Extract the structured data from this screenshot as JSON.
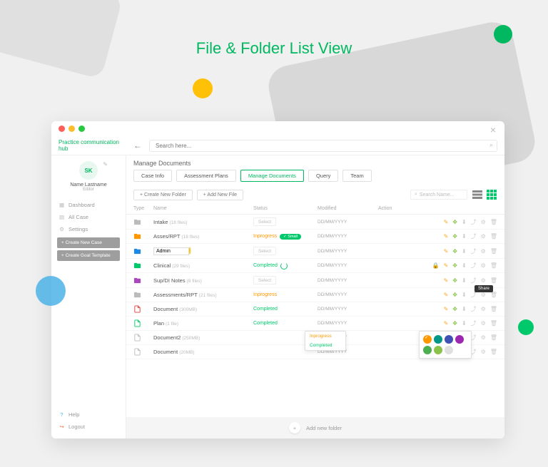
{
  "page_title": "File & Folder List View",
  "brand": "Practice communication hub",
  "search_placeholder": "Search here...",
  "user": {
    "initials": "SK",
    "name": "Name Lastname",
    "role": "Editor"
  },
  "nav": [
    {
      "icon": "▦",
      "label": "Dashboard"
    },
    {
      "icon": "▤",
      "label": "All Case"
    },
    {
      "icon": "⚙",
      "label": "Settings"
    }
  ],
  "sidebar_buttons": [
    "+ Create New Case",
    "+ Create Goal Template"
  ],
  "bottom_nav": [
    {
      "icon": "?",
      "label": "Help"
    },
    {
      "icon": "↪",
      "label": "Logout"
    }
  ],
  "main_header": "Manage Documents",
  "tabs": [
    "Case Info",
    "Assessment Plans",
    "Manage Documents",
    "Query",
    "Team"
  ],
  "active_tab": 2,
  "toolbar": {
    "new_folder": "+ Create New Folder",
    "new_file": "+ Add New File",
    "search_ph": "Search Name..."
  },
  "columns": [
    "Type",
    "Name",
    "Status",
    "Modified",
    "Action"
  ],
  "rows": [
    {
      "icon_color": "fc-gray",
      "type": "folder",
      "name": "Intake",
      "meta": "(18 files)",
      "status": {
        "kind": "select",
        "text": "Select"
      },
      "modified": "DD/MM/YYYY",
      "actions": [
        "pen",
        "move",
        "download",
        "share",
        "gear",
        "trash"
      ]
    },
    {
      "icon_color": "fc-orange",
      "type": "folder",
      "name": "Asses/RPT",
      "meta": "(18 files)",
      "status": {
        "kind": "inprogress",
        "text": "Inprogress",
        "badge": "Small"
      },
      "modified": "DD/MM/YYYY",
      "actions": [
        "pen",
        "move",
        "download",
        "share",
        "gear",
        "trash"
      ]
    },
    {
      "icon_color": "fc-blue",
      "type": "folder",
      "name": "Admin",
      "meta": "",
      "editing": true,
      "status": {
        "kind": "select",
        "text": "Select"
      },
      "modified": "DD/MM/YYYY",
      "actions": [
        "pen",
        "move",
        "download",
        "share",
        "gear",
        "trash"
      ]
    },
    {
      "icon_color": "fc-green",
      "type": "folder",
      "name": "Clinical",
      "meta": "(29 files)",
      "status": {
        "kind": "completed",
        "text": "Completed",
        "spinner": true
      },
      "modified": "DD/MM/YYYY",
      "actions": [
        "lock",
        "pen",
        "move",
        "download",
        "share",
        "gear",
        "trash"
      ],
      "tooltip": "Share"
    },
    {
      "icon_color": "fc-purple",
      "type": "folder",
      "name": "Sup/DI Notes",
      "meta": "(8 files)",
      "status": {
        "kind": "select",
        "text": "Select"
      },
      "modified": "DD/MM/YYYY",
      "actions": [
        "pen",
        "move",
        "download",
        "share",
        "gear",
        "trash"
      ]
    },
    {
      "icon_color": "fc-gray",
      "type": "folder",
      "name": "Assessments/RPT",
      "meta": "(21 files)",
      "status": {
        "kind": "inprogress",
        "text": "Inprogress"
      },
      "modified": "DD/MM/YYYY",
      "actions": [
        "pen",
        "move",
        "download",
        "share",
        "gear",
        "trash"
      ]
    },
    {
      "icon_color": "fc-red",
      "type": "pdf",
      "name": "Document",
      "meta": "(300MB)",
      "status": {
        "kind": "completed",
        "text": "Completed"
      },
      "modified": "DD/MM/YYYY",
      "actions": [
        "pen",
        "move",
        "download",
        "share",
        "gear",
        "trash"
      ]
    },
    {
      "icon_color": "fc-green",
      "type": "file",
      "name": "Plan",
      "meta": "(1 file)",
      "status": {
        "kind": "completed",
        "text": "Completed"
      },
      "modified": "DD/MM/YYYY",
      "actions": [
        "pen",
        "move",
        "download",
        "share",
        "gear",
        "trash"
      ]
    },
    {
      "icon_color": "fc-gray",
      "type": "doc",
      "name": "Document2",
      "meta": "(250MB)",
      "status": {
        "kind": "none"
      },
      "modified": "DD/MM/YYYY",
      "actions": [
        "pen",
        "move",
        "download",
        "share",
        "gear",
        "trash"
      ]
    },
    {
      "icon_color": "fc-gray",
      "type": "file",
      "name": "Document",
      "meta": "(20MB)",
      "status": {
        "kind": "none"
      },
      "modified": "DD/MM/YYYY",
      "actions": [
        "pen",
        "move",
        "download",
        "share",
        "gear",
        "trash"
      ]
    }
  ],
  "status_dropdown": [
    "Inprogress",
    "Completed"
  ],
  "color_palette": [
    "#ff9800",
    "#009688",
    "#3f51b5",
    "#9c27b0",
    "#4caf50",
    "#8bc34a",
    "#e0e0e0"
  ],
  "footer": "Add new folder"
}
